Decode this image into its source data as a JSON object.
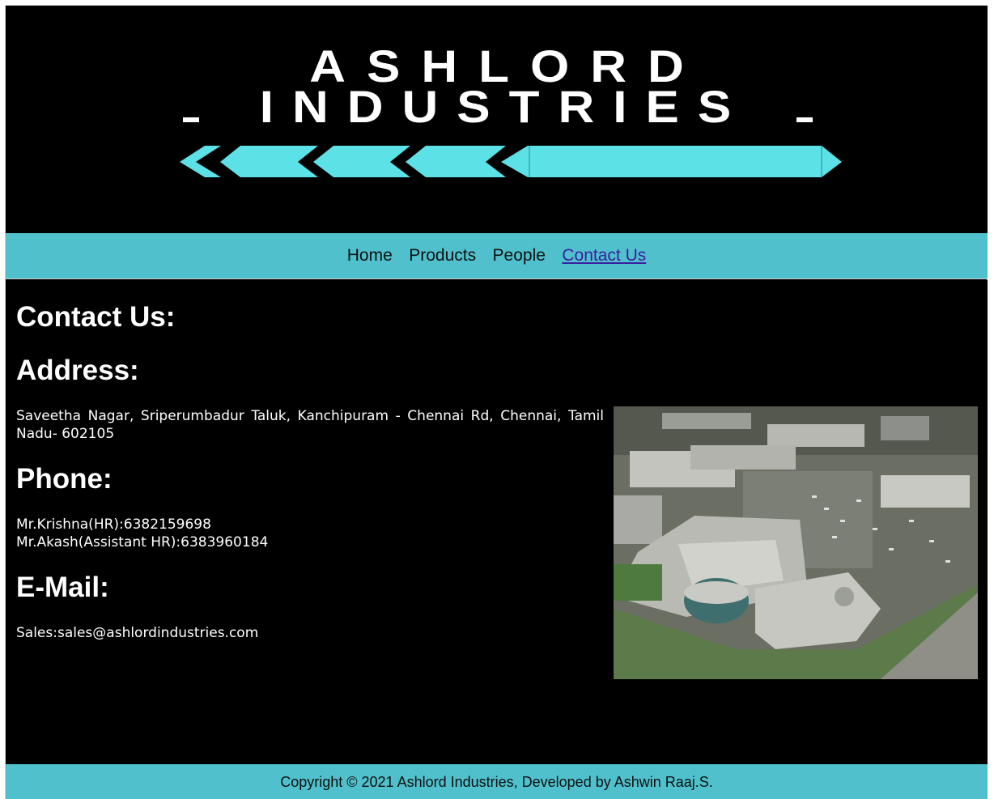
{
  "header": {
    "logo_line1": "ASHLORD",
    "logo_line2": "INDUSTRIES",
    "accent_color": "#5ce1e6"
  },
  "nav": {
    "items": [
      {
        "label": "Home"
      },
      {
        "label": "Products"
      },
      {
        "label": "People"
      },
      {
        "label": "Contact Us",
        "active": true
      }
    ],
    "background": "#4fc0cc"
  },
  "main": {
    "title": "Contact Us:",
    "address_heading": "Address:",
    "address_text": "Saveetha Nagar, Sriperumbadur Taluk, Kanchipuram - Chennai Rd, Chennai, Tamil Nadu- 602105",
    "phone_heading": "Phone:",
    "phones": [
      "Mr.Krishna(HR):6382159698",
      "Mr.Akash(Assistant HR):6383960184"
    ],
    "email_heading": "E-Mail:",
    "email_text": "Sales:sales@ashlordindustries.com",
    "image": "aerial-facility-photo"
  },
  "footer": {
    "text": "Copyright © 2021 Ashlord Industries, Developed by Ashwin Raaj.S."
  }
}
